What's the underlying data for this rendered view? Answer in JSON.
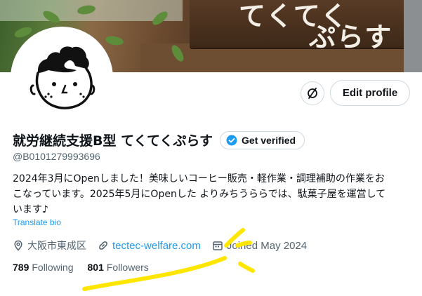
{
  "banner": {
    "sign_line1": "てくてく",
    "sign_line2": "ぷらす"
  },
  "actions": {
    "edit_profile_label": "Edit profile",
    "icon_button": "no-signal-icon"
  },
  "profile": {
    "display_name": "就労継続支援B型 てくてくぷらす",
    "get_verified_label": "Get verified",
    "handle": "@B0101279993696",
    "bio_lines": [
      "2024年3月にOpenしました！美味しいコーヒー販売・軽作業・調理補助の作業をお",
      "こなっています。2025年5月にOpenした よりみちうららでは、駄菓子屋を運営して",
      "います♪"
    ],
    "translate_label": "Translate bio",
    "location": "大阪市東成区",
    "website": "tectec-welfare.com",
    "joined": "Joined May 2024",
    "following_count": "789",
    "following_label": "Following",
    "followers_count": "801",
    "followers_label": "Followers"
  },
  "colors": {
    "link": "#1d9bf0",
    "muted": "#536471",
    "text": "#0f1419",
    "annotation": "#ffe600"
  }
}
